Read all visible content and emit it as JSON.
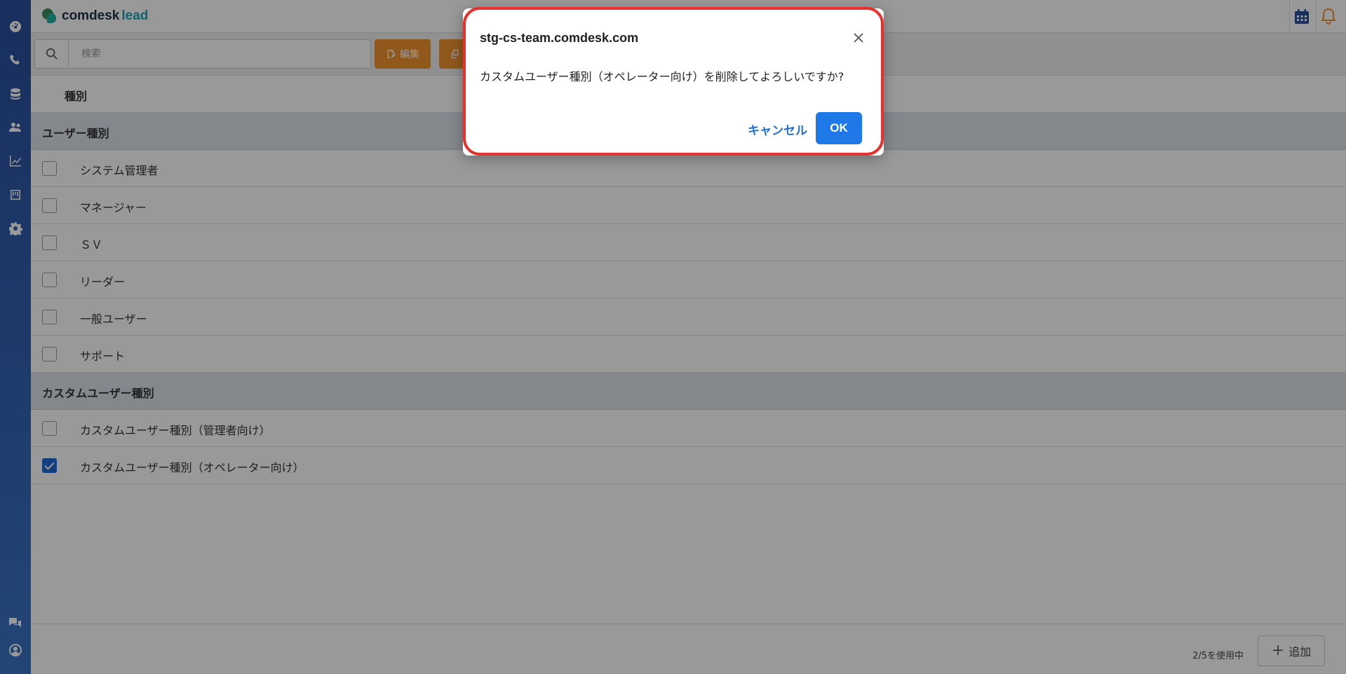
{
  "brand": {
    "name": "comdesk",
    "suffix": "lead"
  },
  "search": {
    "placeholder": "検索"
  },
  "toolbar": {
    "edit_label": "編集"
  },
  "table": {
    "column_header": "種別",
    "groups": [
      {
        "label": "ユーザー種別",
        "rows": [
          {
            "label": "システム管理者",
            "checked": false
          },
          {
            "label": "マネージャー",
            "checked": false
          },
          {
            "label": "ＳＶ",
            "checked": false
          },
          {
            "label": "リーダー",
            "checked": false
          },
          {
            "label": "一般ユーザー",
            "checked": false
          },
          {
            "label": "サポート",
            "checked": false
          }
        ]
      },
      {
        "label": "カスタムユーザー種別",
        "rows": [
          {
            "label": "カスタムユーザー種別（管理者向け）",
            "checked": false
          },
          {
            "label": "カスタムユーザー種別（オペレーター向け）",
            "checked": true
          }
        ]
      }
    ]
  },
  "footer": {
    "usage": "2/5を使用中",
    "add_label": "追加"
  },
  "dialog": {
    "title": "stg-cs-team.comdesk.com",
    "message": "カスタムユーザー種別（オペレーター向け）を削除してよろしいですか?",
    "cancel_label": "キャンセル",
    "ok_label": "OK"
  },
  "colors": {
    "accent_orange": "#f0952e",
    "primary_blue": "#1f78e8",
    "highlight_red": "#e8312c",
    "sidebar": "#2a4f9c"
  }
}
